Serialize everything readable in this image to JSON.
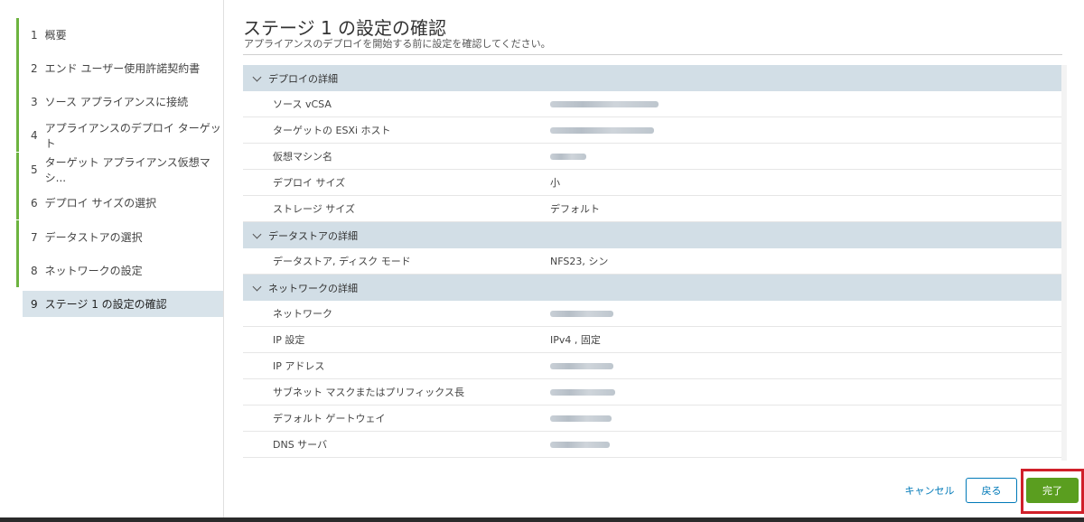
{
  "sidebar": {
    "steps": [
      {
        "num": "1",
        "label": "概要"
      },
      {
        "num": "2",
        "label": "エンド ユーザー使用許諾契約書"
      },
      {
        "num": "3",
        "label": "ソース アプライアンスに接続"
      },
      {
        "num": "4",
        "label": "アプライアンスのデプロイ ターゲット"
      },
      {
        "num": "5",
        "label": "ターゲット アプライアンス仮想マシ..."
      },
      {
        "num": "6",
        "label": "デプロイ サイズの選択"
      },
      {
        "num": "7",
        "label": "データストアの選択"
      },
      {
        "num": "8",
        "label": "ネットワークの設定"
      },
      {
        "num": "9",
        "label": "ステージ 1 の設定の確認"
      }
    ]
  },
  "main": {
    "title": "ステージ 1 の設定の確認",
    "subtitle": "アプライアンスのデプロイを開始する前に設定を確認してください。"
  },
  "sections": [
    {
      "title": "デプロイの詳細",
      "rows": [
        {
          "label": "ソース vCSA",
          "value": ""
        },
        {
          "label": "ターゲットの ESXi ホスト",
          "value": ""
        },
        {
          "label": "仮想マシン名",
          "value": ""
        },
        {
          "label": "デプロイ サイズ",
          "value": "小"
        },
        {
          "label": "ストレージ サイズ",
          "value": "デフォルト"
        }
      ]
    },
    {
      "title": "データストアの詳細",
      "rows": [
        {
          "label": "データストア, ディスク モード",
          "value": "NFS23, シン"
        }
      ]
    },
    {
      "title": "ネットワークの詳細",
      "rows": [
        {
          "label": "ネットワーク",
          "value": ""
        },
        {
          "label": "IP 設定",
          "value": "IPv4 , 固定"
        },
        {
          "label": "IP アドレス",
          "value": ""
        },
        {
          "label": "サブネット マスクまたはプリフィックス長",
          "value": ""
        },
        {
          "label": "デフォルト ゲートウェイ",
          "value": ""
        },
        {
          "label": "DNS サーバ",
          "value": ""
        }
      ]
    }
  ],
  "footer": {
    "cancel_label": "キャンセル",
    "back_label": "戻る",
    "finish_label": "完了"
  },
  "colors": {
    "accent": "#0079b8",
    "progress": "#6db33f",
    "finish": "#5a9e1f",
    "highlight": "#d0202a",
    "section_header": "#d2dee6"
  }
}
